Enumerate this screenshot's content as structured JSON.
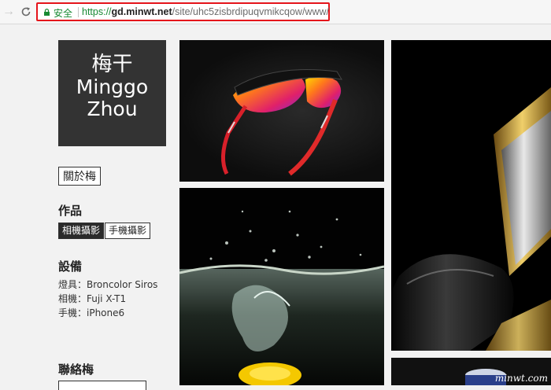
{
  "browser": {
    "secure_label": "安全",
    "url_scheme": "https://",
    "url_host": "gd.minwt.net",
    "url_path": "/site/uhc5zisbrdipuqvmikcqow/www/"
  },
  "sidebar": {
    "logo_line1": "梅干",
    "logo_line2": "Minggo",
    "logo_line3": "Zhou",
    "about_label": "關於梅",
    "works_title": "作品",
    "works_tags": [
      "相機攝影",
      "手機攝影"
    ],
    "gear_title": "設備",
    "gear_items": [
      "燈具：Broncolor Siros",
      "相機：Fuji X-T1",
      "手機：iPhone6"
    ],
    "contact_title": "聯絡梅"
  },
  "watermark": "minwt.com"
}
